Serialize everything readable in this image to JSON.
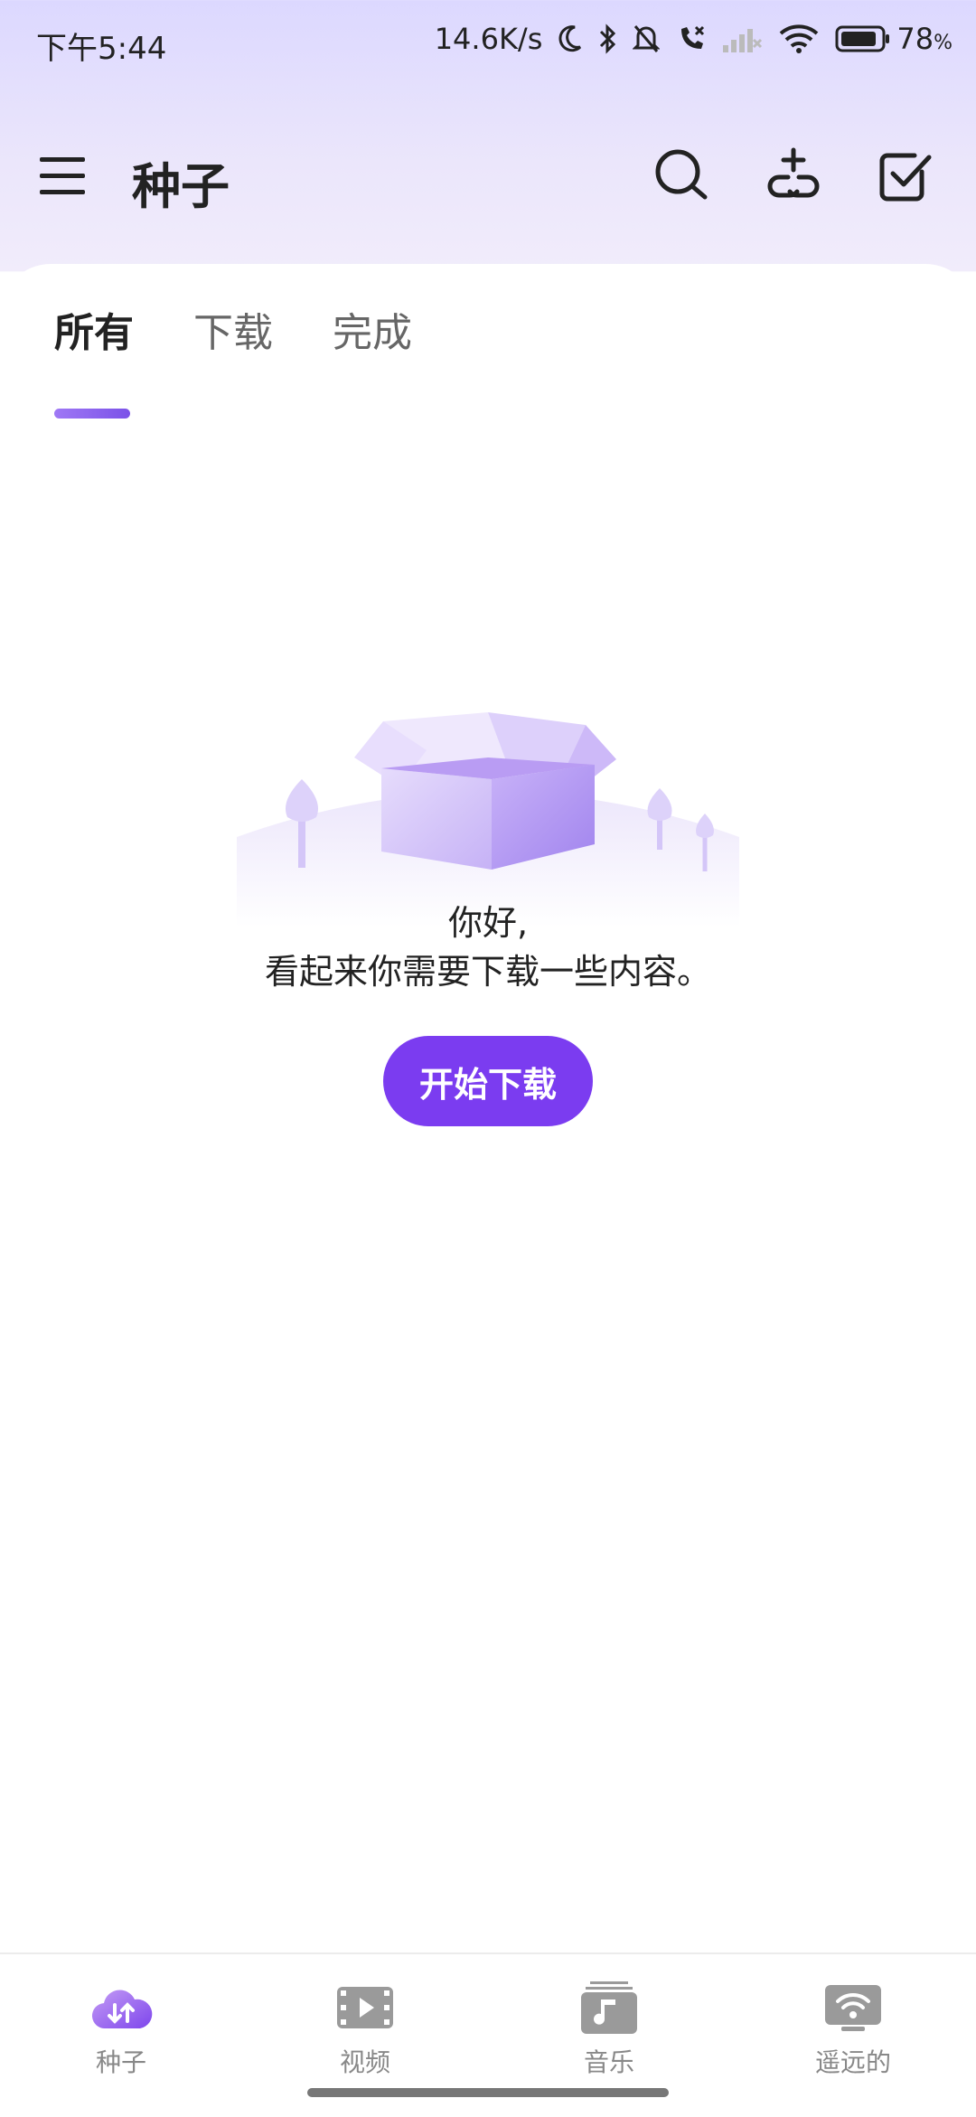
{
  "status": {
    "time": "下午5:44",
    "speed": "14.6K/s",
    "battery": "78",
    "battery_unit": "%"
  },
  "app_bar": {
    "title": "种子"
  },
  "tabs": [
    {
      "label": "所有",
      "active": true
    },
    {
      "label": "下载",
      "active": false
    },
    {
      "label": "完成",
      "active": false
    }
  ],
  "empty_state": {
    "line1": "你好,",
    "line2": "看起来你需要下载一些内容。",
    "button": "开始下载"
  },
  "bottom_nav": [
    {
      "label": "种子",
      "icon": "cloud-transfer-icon",
      "active": true
    },
    {
      "label": "视频",
      "icon": "film-icon",
      "active": false
    },
    {
      "label": "音乐",
      "icon": "music-icon",
      "active": false
    },
    {
      "label": "遥远的",
      "icon": "remote-wifi-icon",
      "active": false
    }
  ],
  "colors": {
    "accent": "#7b3cf0",
    "tab_indicator": "#8f66f0"
  }
}
